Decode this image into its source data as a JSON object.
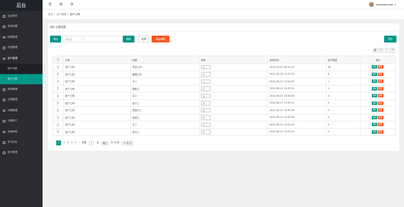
{
  "app": {
    "title": "后台"
  },
  "sidebar": {
    "items": [
      {
        "label": "后台首页",
        "arrow": ""
      },
      {
        "label": "系统设置",
        "arrow": "‹"
      },
      {
        "label": "权限管理",
        "arrow": "‹"
      },
      {
        "label": "内容管理",
        "arrow": "‹"
      },
      {
        "label": "用户管理",
        "arrow": "⌄"
      }
    ],
    "sub_items": [
      {
        "label": "用户列表"
      },
      {
        "label": "用户工种"
      }
    ],
    "items_after": [
      {
        "label": "案场管理",
        "arrow": ""
      },
      {
        "label": "分类管理",
        "arrow": ""
      },
      {
        "label": "分期管理",
        "arrow": "‹"
      },
      {
        "label": "分期部门",
        "arrow": ""
      },
      {
        "label": "页面审核",
        "arrow": "‹"
      },
      {
        "label": "学习论坛",
        "arrow": ""
      },
      {
        "label": "统计管理",
        "arrow": "‹"
      }
    ]
  },
  "topbar": {
    "icons": [
      "menu-icon",
      "settings-icon",
      "refresh-icon"
    ],
    "icon_glyphs": [
      "☰",
      "⚙",
      "⟳"
    ],
    "user_name": "welyboeitylae"
  },
  "breadcrumb": {
    "home": "首页",
    "parent": "用户管理",
    "current": "用户工种"
  },
  "card": {
    "title": "用户工种列表"
  },
  "filters": {
    "add_label": "添加",
    "select_placeholder": "请选择",
    "search_label": "搜索",
    "reset_label": "重置",
    "batch_delete_label": "批量删除",
    "export_label": "导出"
  },
  "toolbar_icons": [
    "filter-icon",
    "print-icon",
    "export-icon",
    "columns-icon"
  ],
  "toolbar_glyphs": [
    "▦",
    "⎙",
    "⇩",
    "☷"
  ],
  "table": {
    "headers": [
      "",
      "分类",
      "标题",
      "排序",
      "添加时间",
      "用户数量",
      "操作"
    ],
    "edit_label": "编辑",
    "delete_label": "删除",
    "rows": [
      {
        "category": "用户工种",
        "title": "项目公司",
        "sort": "0",
        "time": "2022-03-01 09:54:47",
        "count": "28"
      },
      {
        "category": "用户工种",
        "title": "管理人员",
        "sort": "0",
        "time": "2022-09-30 14:37:25",
        "count": "6"
      },
      {
        "category": "用户工种",
        "title": "木工",
        "sort": "1",
        "time": "2022-06-21 13:29:42",
        "count": "1"
      },
      {
        "category": "用户工种",
        "title": "钢筋工",
        "sort": "2",
        "time": "2022-06-21 13:29:52",
        "count": "1"
      },
      {
        "category": "用户工种",
        "title": "杂工",
        "sort": "3",
        "time": "2022-06-21 13:30:05",
        "count": "0"
      },
      {
        "category": "用户工种",
        "title": "架子工",
        "sort": "4",
        "time": "2022-06-21 13:30:22",
        "count": "0"
      },
      {
        "category": "用户工种",
        "title": "混凝土工",
        "sort": "5",
        "time": "2022-06-21 13:30:36",
        "count": "0"
      },
      {
        "category": "用户工种",
        "title": "电焊工",
        "sort": "6",
        "time": "2022-06-21 13:30:50",
        "count": "0"
      },
      {
        "category": "用户工种",
        "title": "瓦工",
        "sort": "7",
        "time": "2022-06-21 13:31:02",
        "count": "0"
      },
      {
        "category": "用户工种",
        "title": "防水工",
        "sort": "8",
        "time": "2022-06-21 13:31:13",
        "count": "0"
      }
    ]
  },
  "pager": {
    "pages": [
      "1",
      "2",
      "3",
      "4",
      "5"
    ],
    "next": "›",
    "goto_label": "到第",
    "current_input": "1",
    "page_unit": "页",
    "confirm_label": "确定",
    "total": "共 48 条",
    "page_size": "10 条/页"
  }
}
